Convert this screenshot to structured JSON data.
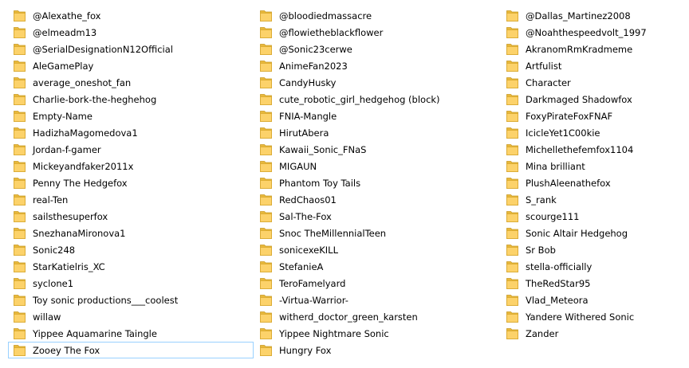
{
  "colors": {
    "folder_back": "#e8b83b",
    "folder_front": "#fcd26a",
    "selection_border": "#99d1ff"
  },
  "selected_item": "Zooey The Fox",
  "columns": [
    {
      "items": [
        "@Alexathe_fox",
        "@elmeadm13",
        "@SerialDesignationN12Official",
        "AleGamePlay",
        "average_oneshot_fan",
        "Charlie-bork-the-heghehog",
        "Empty-Name",
        "HadizhaMagomedova1",
        "Jordan-f-gamer",
        "Mickeyandfaker2011x",
        "Penny The Hedgefox",
        "real-Ten",
        "sailsthesuperfox",
        "SnezhanaMironova1",
        "Sonic248",
        "StarKatielris_XC",
        "syclone1",
        "Toy sonic productions___coolest",
        "willaw",
        "Yippee Aquamarine Taingle",
        "Zooey The Fox"
      ]
    },
    {
      "items": [
        "@bloodiedmassacre",
        "@flowietheblackflower",
        "@Sonic23cerwe",
        "AnimeFan2023",
        "CandyHusky",
        "cute_robotic_girl_hedgehog (block)",
        "FNIA-Mangle",
        "HirutAbera",
        "Kawaii_Sonic_FNaS",
        "MIGAUN",
        "Phantom Toy Tails",
        "RedChaos01",
        "Sal-The-Fox",
        "Snoc TheMillennialTeen",
        "sonicexeKILL",
        "StefanieA",
        "TeroFamelyard",
        "-Virtua-Warrior-",
        "witherd_doctor_green_karsten",
        "Yippee Nightmare Sonic",
        "Hungry Fox"
      ]
    },
    {
      "items": [
        "@Dallas_Martinez2008",
        "@Noahthespeedvolt_1997",
        "AkranomRmKradmeme",
        "Artfulist",
        "Character",
        "Darkmaged Shadowfox",
        "FoxyPirateFoxFNAF",
        "IcicleYet1C00kie",
        "Michellethefemfox1104",
        "Mina brilliant",
        "PlushAleenathefox",
        "S_rank",
        "scourge111",
        "Sonic Altair Hedgehog",
        "Sr Bob",
        "stella-officially",
        "TheRedStar95",
        "Vlad_Meteora",
        "Yandere Withered Sonic",
        "Zander"
      ]
    }
  ]
}
